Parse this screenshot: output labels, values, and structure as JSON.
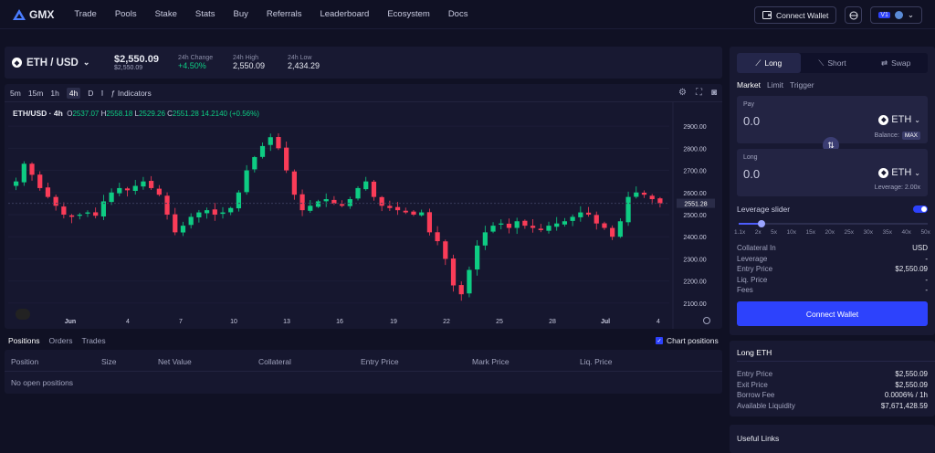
{
  "brand": {
    "name": "GMX"
  },
  "nav": {
    "links": [
      "Trade",
      "Pools",
      "Stake",
      "Stats",
      "Buy",
      "Referrals",
      "Leaderboard",
      "Ecosystem",
      "Docs"
    ],
    "connect_wallet": "Connect Wallet",
    "version": "V1"
  },
  "ticker": {
    "pair": "ETH / USD",
    "price": "$2,550.09",
    "price_small": "$2,550.09",
    "change_label": "24h Change",
    "change_value": "+4.50%",
    "high_label": "24h High",
    "high_value": "2,550.09",
    "low_label": "24h Low",
    "low_value": "2,434.29"
  },
  "chart_toolbar": {
    "intervals": [
      "5m",
      "15m",
      "1h",
      "4h",
      "D"
    ],
    "selected": "4h",
    "indicators": "Indicators"
  },
  "chart_legend": {
    "symbol": "ETH/USD · 4h",
    "o": "2537.07",
    "h": "2558.18",
    "l": "2529.26",
    "c": "2551.28",
    "chg": "14.2140 (+0.56%)"
  },
  "chart_data": {
    "type": "candlestick",
    "y_ticks": [
      "2900.00",
      "2800.00",
      "2700.00",
      "2600.00",
      "2500.00",
      "2400.00",
      "2300.00",
      "2200.00",
      "2100.00"
    ],
    "ylim": [
      2050,
      2950
    ],
    "x_ticks": [
      "Jun",
      "4",
      "7",
      "10",
      "13",
      "16",
      "19",
      "22",
      "25",
      "28",
      "Jul",
      "4"
    ],
    "last_price_label": "2551.28",
    "series": [
      2650,
      2730,
      2680,
      2620,
      2580,
      2540,
      2500,
      2490,
      2500,
      2510,
      2495,
      2560,
      2600,
      2620,
      2610,
      2630,
      2650,
      2620,
      2590,
      2500,
      2420,
      2450,
      2490,
      2510,
      2520,
      2500,
      2510,
      2530,
      2600,
      2700,
      2760,
      2810,
      2850,
      2800,
      2700,
      2590,
      2520,
      2540,
      2560,
      2570,
      2550,
      2540,
      2570,
      2620,
      2650,
      2580,
      2540,
      2530,
      2520,
      2510,
      2500,
      2510,
      2420,
      2380,
      2300,
      2180,
      2140,
      2250,
      2360,
      2420,
      2450,
      2460,
      2440,
      2470,
      2450,
      2440,
      2430,
      2450,
      2460,
      2470,
      2490,
      2510,
      2500,
      2460,
      2440,
      2400,
      2470,
      2580,
      2600,
      2590,
      2570,
      2551
    ]
  },
  "positions": {
    "tabs": [
      "Positions",
      "Orders",
      "Trades"
    ],
    "chart_positions": "Chart positions",
    "columns": [
      "Position",
      "Size",
      "Net Value",
      "Collateral",
      "Entry Price",
      "Mark Price",
      "Liq. Price"
    ],
    "empty": "No open positions"
  },
  "trade_box": {
    "tabs": [
      "Long",
      "Short",
      "Swap"
    ],
    "order_types": [
      "Market",
      "Limit",
      "Trigger"
    ],
    "pay_label": "Pay",
    "pay_amount": "0.0",
    "pay_token": "ETH",
    "balance_label": "Balance:",
    "max": "MAX",
    "long_label": "Long",
    "long_amount": "0.0",
    "long_token": "ETH",
    "leverage_sub": "Leverage: 2.00x",
    "leverage_slider_label": "Leverage slider",
    "leverage_fraction": 0.12,
    "slider_ticks": [
      "1.1x",
      "2x",
      "5x",
      "10x",
      "15x",
      "20x",
      "25x",
      "30x",
      "35x",
      "40x",
      "50x"
    ],
    "rows": [
      {
        "label": "Collateral In",
        "value": "USD"
      },
      {
        "label": "Leverage",
        "value": "-"
      },
      {
        "label": "Entry Price",
        "value": "$2,550.09"
      },
      {
        "label": "Liq. Price",
        "value": "-"
      },
      {
        "label": "Fees",
        "value": "-"
      }
    ],
    "connect_wallet": "Connect Wallet"
  },
  "long_eth": {
    "title": "Long ETH",
    "rows": [
      {
        "label": "Entry Price",
        "value": "$2,550.09"
      },
      {
        "label": "Exit Price",
        "value": "$2,550.09"
      },
      {
        "label": "Borrow Fee",
        "value": "0.0006% / 1h"
      },
      {
        "label": "Available Liquidity",
        "value": "$7,671,428.59"
      }
    ]
  },
  "useful_links": {
    "title": "Useful Links"
  }
}
